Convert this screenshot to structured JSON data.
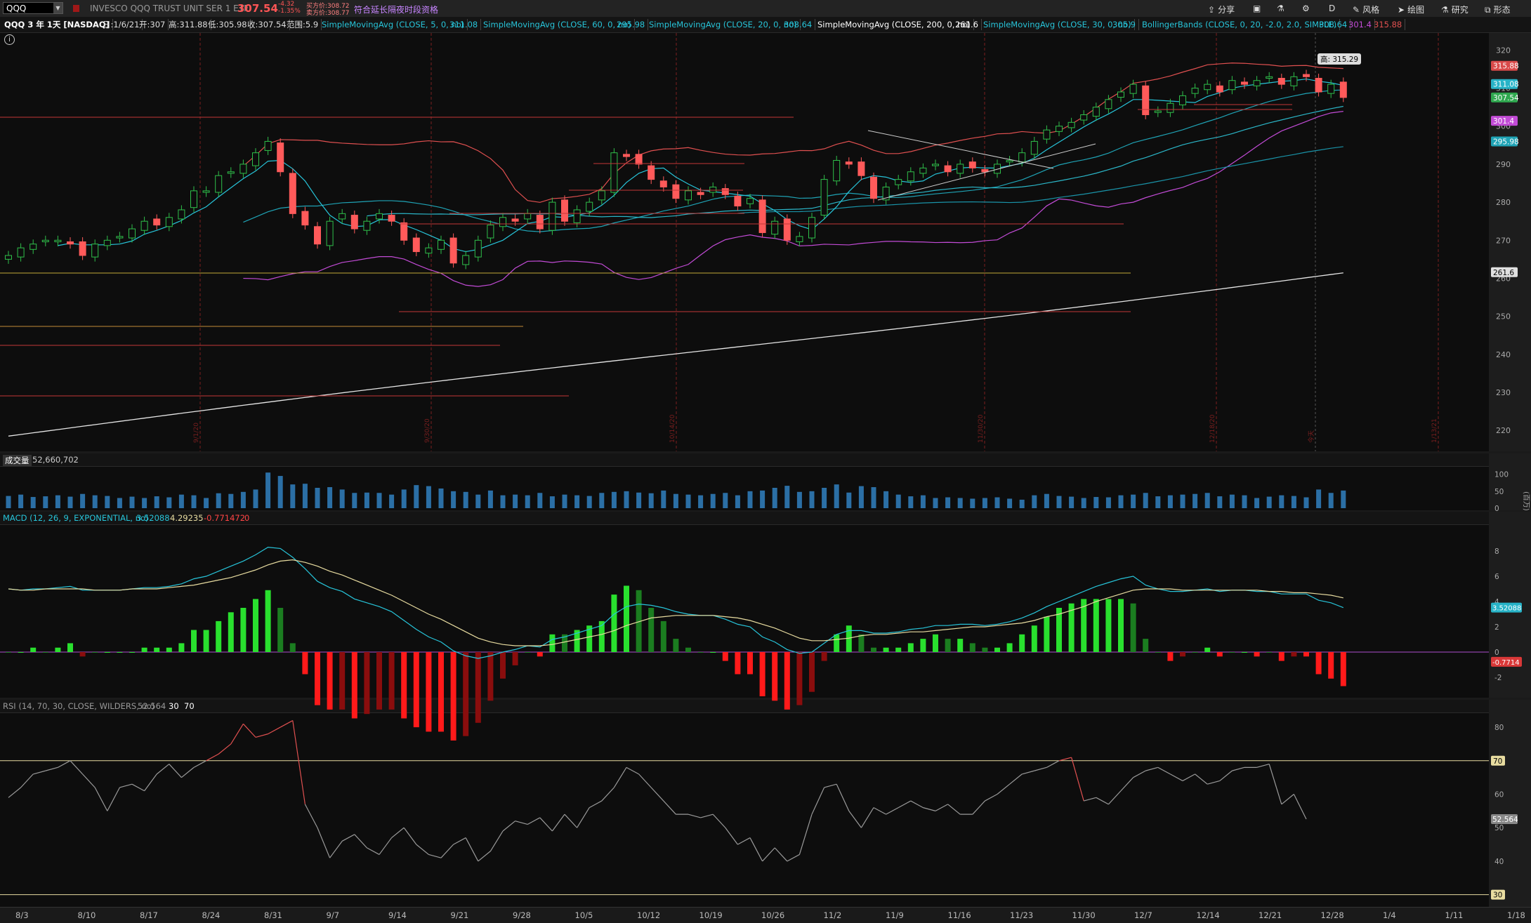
{
  "toolbar": {
    "symbol": "QQQ",
    "description": "INVESCO QQQ TRUST UNIT SER 1 ETF",
    "last": "307.54",
    "change": "-4.32",
    "change_pct": "-1.35%",
    "bid": "买方价:308.72",
    "ask": "卖方价:308.77",
    "extended": "符合延长隔夜时段资格",
    "share": "分享",
    "style": "风格",
    "draw": "绘图",
    "research": "研究",
    "pattern": "形态",
    "period": "D"
  },
  "study_header": {
    "title": "QQQ 3 年 1天 [NASDAQ]",
    "date": "日:1/6/21",
    "open": "开:307",
    "high": "高:311.88",
    "low": "低:305.98",
    "close": "收:307.54",
    "range": "范围:5.9",
    "sma5": "SimpleMovingAvg (CLOSE, 5, 0, no)",
    "sma5_val": "311.08",
    "sma60": "SimpleMovingAvg (CLOSE, 60, 0, no)",
    "sma60_val": "295.98",
    "sma20": "SimpleMovingAvg (CLOSE, 20, 0, no)",
    "sma20_val": "308.64",
    "sma200": "SimpleMovingAvg (CLOSE, 200, 0, no)",
    "sma200_val": "261.6",
    "sma30": "SimpleMovingAvg (CLOSE, 30, 0, no)",
    "sma30_val": "305.9",
    "bb": "BollingerBands (CLOSE, 0, 20, -2.0, 2.0, SIMPLE)",
    "bb_mid": "308.64",
    "bb_low": "301.4",
    "bb_up": "315.88"
  },
  "price_axis": {
    "ticks": [
      "320",
      "310",
      "300",
      "290",
      "280",
      "270",
      "260",
      "250",
      "240",
      "230",
      "220"
    ],
    "badges": [
      {
        "text": "315.88",
        "value": 315.88,
        "bg": "#d94a4a",
        "fg": "#ffffff"
      },
      {
        "text": "311.08",
        "value": 311.08,
        "bg": "#27b3c7",
        "fg": "#ffffff"
      },
      {
        "text": "307.54",
        "value": 307.54,
        "bg": "#2fa84f",
        "fg": "#ffffff"
      },
      {
        "text": "301.4",
        "value": 301.4,
        "bg": "#c24bd6",
        "fg": "#ffffff"
      },
      {
        "text": "295.98",
        "value": 295.98,
        "bg": "#1fa3b5",
        "fg": "#ffffff"
      },
      {
        "text": "261.6",
        "value": 261.6,
        "bg": "#e0e0e0",
        "fg": "#000000"
      }
    ],
    "high_tag": "高: 315.29",
    "vertical_labels": [
      "8/3/20",
      "9/1/20",
      "9/30/20",
      "10/14/20",
      "11/30/20",
      "12/18/20",
      "今天",
      "1/13/21"
    ]
  },
  "volume": {
    "label": "成交量",
    "value": "52,660,702",
    "ticks": [
      "100",
      "50",
      "0"
    ],
    "unit": "(百万)"
  },
  "macd": {
    "label": "MACD (12, 26, 9, EXPONENTIAL, no)",
    "v1": "3.52088",
    "v2": "4.29235",
    "v3": "-0.771472",
    "v4": "0",
    "ticks": [
      "8",
      "6",
      "4",
      "2",
      "0",
      "-2"
    ],
    "badge_value": "3.52088",
    "badge_diff": "-0.7714"
  },
  "rsi": {
    "label": "RSI (14, 70, 30, CLOSE, WILDERS, no)",
    "value": "52.564",
    "ob": "30",
    "os": "70",
    "ticks": [
      "80",
      "60",
      "50",
      "40"
    ],
    "badge": "52.564"
  },
  "date_axis": [
    "8/3",
    "8/10",
    "8/17",
    "8/24",
    "8/31",
    "9/7",
    "9/14",
    "9/21",
    "9/28",
    "10/5",
    "10/12",
    "10/19",
    "10/26",
    "11/2",
    "11/9",
    "11/16",
    "11/23",
    "11/30",
    "12/7",
    "12/14",
    "12/21",
    "12/28",
    "1/4",
    "1/11",
    "1/18"
  ],
  "colors": {
    "up": "#2fbf4a",
    "down": "#ff5a5a",
    "sma5": "#27c4d9",
    "sma200": "#e6e6e6",
    "bb": "#e05050",
    "macd_pos": "#29e02e",
    "macd_neg": "#ff1a1a"
  },
  "chart_data": {
    "type": "candlestick",
    "dates": [
      "8/3",
      "8/4",
      "8/5",
      "8/6",
      "8/7",
      "8/10",
      "8/11",
      "8/12",
      "8/13",
      "8/14",
      "8/17",
      "8/18",
      "8/19",
      "8/20",
      "8/21",
      "8/24",
      "8/25",
      "8/26",
      "8/27",
      "8/28",
      "8/31",
      "9/1",
      "9/2",
      "9/3",
      "9/4",
      "9/8",
      "9/9",
      "9/10",
      "9/11",
      "9/14",
      "9/15",
      "9/16",
      "9/17",
      "9/18",
      "9/21",
      "9/22",
      "9/23",
      "9/24",
      "9/25",
      "9/28",
      "9/29",
      "9/30",
      "10/1",
      "10/2",
      "10/5",
      "10/6",
      "10/7",
      "10/8",
      "10/9",
      "10/12",
      "10/13",
      "10/14",
      "10/15",
      "10/16",
      "10/19",
      "10/20",
      "10/21",
      "10/22",
      "10/23",
      "10/26",
      "10/27",
      "10/28",
      "10/29",
      "10/30",
      "11/2",
      "11/3",
      "11/4",
      "11/5",
      "11/6",
      "11/9",
      "11/10",
      "11/11",
      "11/12",
      "11/13",
      "11/16",
      "11/17",
      "11/18",
      "11/19",
      "11/20",
      "11/23",
      "11/24",
      "11/25",
      "11/27",
      "11/30",
      "12/1",
      "12/2",
      "12/3",
      "12/4",
      "12/7",
      "12/8",
      "12/9",
      "12/10",
      "12/11",
      "12/14",
      "12/15",
      "12/16",
      "12/17",
      "12/18",
      "12/21",
      "12/22",
      "12/23",
      "12/24",
      "12/28",
      "12/29",
      "12/30",
      "12/31",
      "1/4",
      "1/5",
      "1/6"
    ],
    "close": [
      266,
      268,
      269,
      270,
      270,
      269,
      266,
      269,
      270,
      271,
      273,
      275,
      274,
      276,
      278,
      283,
      283,
      287,
      288,
      290,
      293,
      296,
      288,
      277,
      274,
      269,
      275,
      277,
      273,
      275,
      277,
      275,
      270,
      267,
      268,
      270,
      264,
      266,
      270,
      274,
      276,
      275,
      277,
      273,
      280,
      275,
      278,
      280,
      283,
      293,
      292,
      290,
      286,
      284,
      281,
      283,
      282,
      284,
      282,
      279,
      281,
      272,
      275,
      270,
      271,
      276,
      286,
      291,
      290,
      287,
      281,
      284,
      286,
      288,
      289,
      290,
      288,
      290,
      289,
      288,
      290,
      291,
      293,
      296,
      299,
      300,
      301,
      303,
      305,
      307,
      309,
      311,
      303,
      304,
      306,
      308,
      310,
      311,
      309,
      312,
      311,
      312,
      313,
      311,
      313,
      313,
      309,
      311,
      307.54
    ],
    "volume": [
      36,
      40,
      33,
      35,
      38,
      34,
      42,
      38,
      36,
      30,
      34,
      30,
      35,
      32,
      40,
      38,
      30,
      44,
      42,
      48,
      55,
      105,
      95,
      70,
      72,
      60,
      62,
      55,
      45,
      46,
      45,
      40,
      55,
      68,
      65,
      58,
      50,
      48,
      40,
      52,
      38,
      40,
      38,
      45,
      35,
      40,
      38,
      36,
      45,
      48,
      50,
      46,
      44,
      52,
      42,
      40,
      38,
      42,
      45,
      38,
      50,
      52,
      60,
      66,
      48,
      50,
      60,
      70,
      46,
      65,
      62,
      50,
      40,
      35,
      38,
      30,
      32,
      30,
      28,
      30,
      32,
      28,
      25,
      38,
      42,
      36,
      34,
      30,
      33,
      32,
      38,
      40,
      45,
      35,
      38,
      40,
      42,
      45,
      35,
      40,
      38,
      30,
      34,
      38,
      36,
      32,
      55,
      45,
      52
    ],
    "macd": [
      5.0,
      4.9,
      5.0,
      5.0,
      5.1,
      5.2,
      4.9,
      4.9,
      4.9,
      4.9,
      5.0,
      5.1,
      5.1,
      5.2,
      5.4,
      5.8,
      6.0,
      6.4,
      6.8,
      7.2,
      7.7,
      8.3,
      8.2,
      7.5,
      6.6,
      5.6,
      5.1,
      4.8,
      4.2,
      3.9,
      3.6,
      3.2,
      2.5,
      1.8,
      1.2,
      0.8,
      0.1,
      -0.3,
      -0.5,
      -0.3,
      0,
      0.2,
      0.5,
      0.4,
      1.0,
      1.2,
      1.5,
      1.8,
      2.1,
      3.0,
      3.6,
      3.8,
      3.7,
      3.5,
      3.2,
      3.0,
      2.9,
      2.9,
      2.6,
      2.2,
      2.0,
      1.2,
      0.8,
      0.2,
      -0.1,
      0,
      0.7,
      1.4,
      1.7,
      1.7,
      1.5,
      1.5,
      1.6,
      1.8,
      1.9,
      2.1,
      2.1,
      2.2,
      2.2,
      2.1,
      2.2,
      2.4,
      2.7,
      3.1,
      3.6,
      4.0,
      4.4,
      4.8,
      5.2,
      5.5,
      5.8,
      6.0,
      5.3,
      5.0,
      4.8,
      4.8,
      4.9,
      5.0,
      4.8,
      4.9,
      4.9,
      4.8,
      4.8,
      4.6,
      4.6,
      4.6,
      4.1,
      3.9,
      3.52
    ],
    "signal": [
      5.0,
      4.9,
      4.9,
      5.0,
      5.0,
      5.0,
      5.0,
      4.9,
      4.9,
      4.9,
      5.0,
      5.0,
      5.0,
      5.1,
      5.2,
      5.3,
      5.5,
      5.7,
      5.9,
      6.2,
      6.5,
      6.9,
      7.2,
      7.3,
      7.1,
      6.8,
      6.4,
      6.1,
      5.7,
      5.3,
      4.9,
      4.5,
      4.0,
      3.5,
      3.0,
      2.6,
      2.1,
      1.6,
      1.1,
      0.8,
      0.6,
      0.5,
      0.5,
      0.5,
      0.6,
      0.8,
      1.0,
      1.2,
      1.4,
      1.7,
      2.1,
      2.4,
      2.7,
      2.8,
      2.9,
      2.9,
      2.9,
      2.9,
      2.8,
      2.7,
      2.5,
      2.2,
      1.9,
      1.5,
      1.1,
      0.9,
      0.9,
      1.0,
      1.1,
      1.3,
      1.4,
      1.4,
      1.5,
      1.6,
      1.6,
      1.7,
      1.8,
      1.9,
      2.0,
      2.0,
      2.1,
      2.2,
      2.3,
      2.5,
      2.8,
      3.0,
      3.3,
      3.6,
      4.0,
      4.3,
      4.6,
      4.9,
      5.0,
      5.0,
      5.0,
      4.9,
      4.9,
      4.9,
      4.9,
      4.9,
      4.9,
      4.9,
      4.8,
      4.8,
      4.7,
      4.7,
      4.6,
      4.5,
      4.29
    ],
    "rsi": [
      59,
      62,
      66,
      67,
      68,
      70,
      66,
      62,
      55,
      62,
      63,
      61,
      66,
      69,
      65,
      68,
      70,
      72,
      75,
      81,
      77,
      78,
      80,
      82,
      57,
      50,
      41,
      46,
      48,
      44,
      42,
      47,
      50,
      45,
      42,
      41,
      45,
      47,
      40,
      43,
      49,
      52,
      51,
      53,
      49,
      54,
      50,
      56,
      58,
      62,
      68,
      66,
      62,
      58,
      54,
      54,
      53,
      54,
      50,
      45,
      47,
      40,
      44,
      40,
      42,
      54,
      62,
      63,
      55,
      50,
      56,
      54,
      56,
      58,
      56,
      55,
      57,
      54,
      54,
      58,
      60,
      63,
      66,
      67,
      68,
      70,
      71,
      58,
      59,
      57,
      61,
      65,
      67,
      68,
      66,
      64,
      66,
      63,
      64,
      67,
      68,
      68,
      69,
      57,
      60,
      52.56
    ]
  }
}
